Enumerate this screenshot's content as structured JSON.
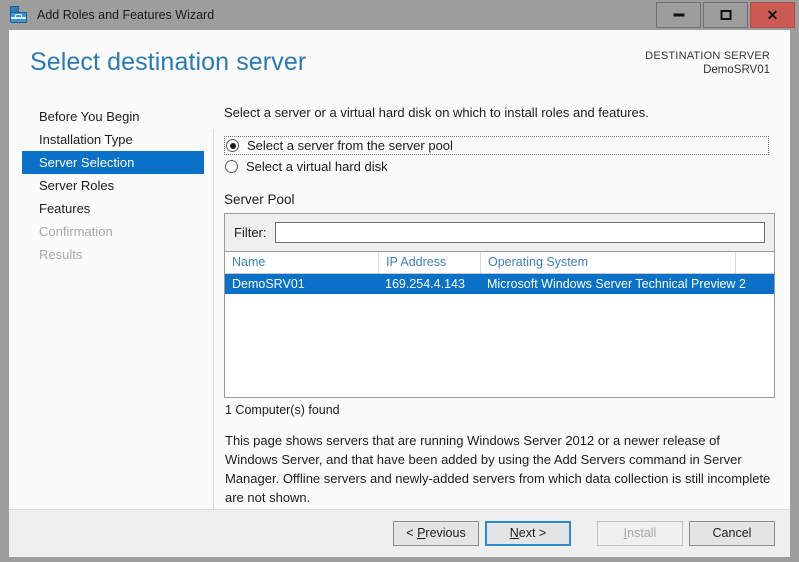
{
  "window": {
    "title": "Add Roles and Features Wizard",
    "icon": "server-toolbox-icon",
    "minimize_label": "Minimize",
    "maximize_label": "Maximize",
    "close_label": "Close",
    "close_glyph": "✕",
    "titlebar_color": "#9d9d9d",
    "close_color": "#cb5a52"
  },
  "header": {
    "page_title": "Select destination server",
    "destination_label": "DESTINATION SERVER",
    "destination_value": "DemoSRV01",
    "accent_color": "#2b7ab3"
  },
  "sidebar": {
    "items": [
      {
        "label": "Before You Begin",
        "state": "normal"
      },
      {
        "label": "Installation Type",
        "state": "normal"
      },
      {
        "label": "Server Selection",
        "state": "selected"
      },
      {
        "label": "Server Roles",
        "state": "normal"
      },
      {
        "label": "Features",
        "state": "normal"
      },
      {
        "label": "Confirmation",
        "state": "disabled"
      },
      {
        "label": "Results",
        "state": "disabled"
      }
    ],
    "selected_color": "#0a71c8"
  },
  "main": {
    "intro": "Select a server or a virtual hard disk on which to install roles and features.",
    "radios": [
      {
        "label": "Select a server from the server pool",
        "checked": true,
        "focused": true
      },
      {
        "label": "Select a virtual hard disk",
        "checked": false,
        "focused": false
      }
    ],
    "section_title": "Server Pool",
    "filter": {
      "label": "Filter:",
      "value": "",
      "placeholder": ""
    },
    "table": {
      "columns": [
        "Name",
        "IP Address",
        "Operating System",
        ""
      ],
      "rows": [
        {
          "selected": true,
          "cells": [
            "DemoSRV01",
            "169.254.4.143",
            "Microsoft Windows Server Technical Preview 2",
            ""
          ]
        }
      ],
      "header_color": "#3f7fbe",
      "selection_color": "#0a71c8"
    },
    "found_text": "1 Computer(s) found",
    "description": "This page shows servers that are running Windows Server 2012 or a newer release of Windows Server, and that have been added by using the Add Servers command in Server Manager. Offline servers and newly-added servers from which data collection is still incomplete are not shown."
  },
  "footer": {
    "buttons": [
      {
        "name": "previous",
        "prefix": "< ",
        "accel": "P",
        "suffix": "revious",
        "state": "normal"
      },
      {
        "name": "next",
        "prefix": "",
        "accel": "N",
        "suffix": "ext >",
        "state": "default"
      },
      {
        "name": "install",
        "prefix": "",
        "accel": "I",
        "suffix": "nstall",
        "state": "disabled"
      },
      {
        "name": "cancel",
        "prefix": "",
        "accel": "",
        "suffix": "Cancel",
        "state": "normal"
      }
    ]
  }
}
